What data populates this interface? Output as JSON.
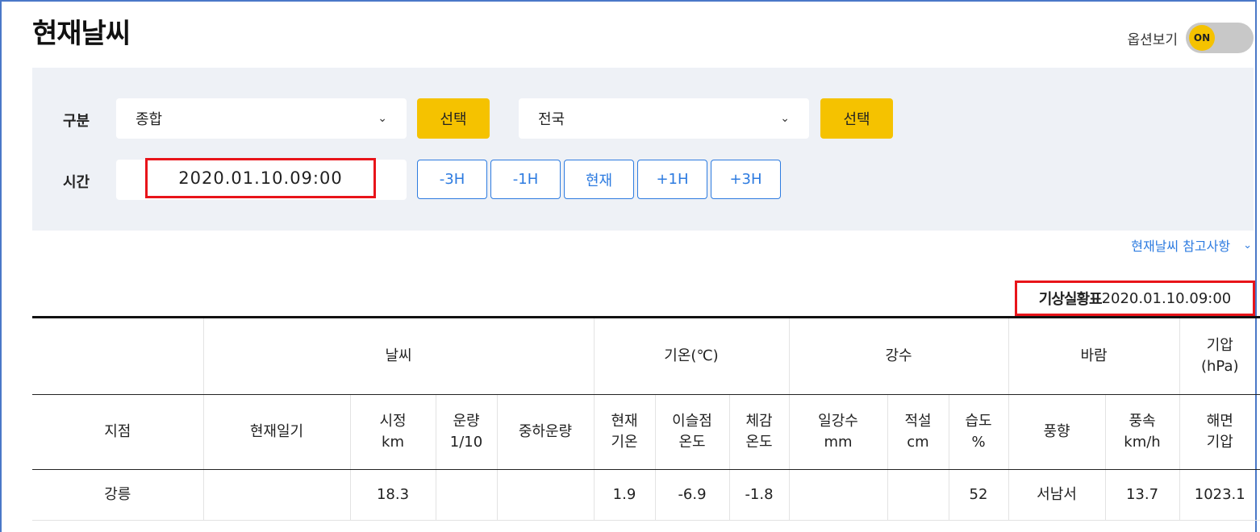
{
  "page": {
    "title": "현재날씨"
  },
  "options": {
    "label": "옵션보기",
    "toggle": "ON"
  },
  "filters": {
    "category_label": "구분",
    "category_value": "종합",
    "region_value": "전국",
    "select_button": "선택",
    "time_label": "시간",
    "time_value": "2020.01.10.09:00",
    "time_buttons": [
      "-3H",
      "-1H",
      "현재",
      "+1H",
      "+3H"
    ]
  },
  "reference_link": "현재날씨 참고사항",
  "table": {
    "caption_bold": "기상실황표",
    "caption_time": "2020.01.10.09:00",
    "groups": [
      "날씨",
      "기온(℃)",
      "강수",
      "바람",
      "기압\n(hPa)"
    ],
    "columns": [
      "지점",
      "현재일기",
      "시정\nkm",
      "운량\n1/10",
      "중하운량",
      "현재\n기온",
      "이슬점\n온도",
      "체감\n온도",
      "일강수\nmm",
      "적설\ncm",
      "습도\n%",
      "풍향",
      "풍속\nkm/h",
      "해면\n기압"
    ],
    "rows": [
      [
        "강릉",
        "",
        "18.3",
        "",
        "",
        "1.9",
        "-6.9",
        "-1.8",
        "",
        "",
        "52",
        "서남서",
        "13.7",
        "1023.1"
      ]
    ]
  },
  "colors": {
    "accent_yellow": "#f5c200",
    "accent_blue": "#2d7be0",
    "highlight_red": "#e8141a"
  }
}
